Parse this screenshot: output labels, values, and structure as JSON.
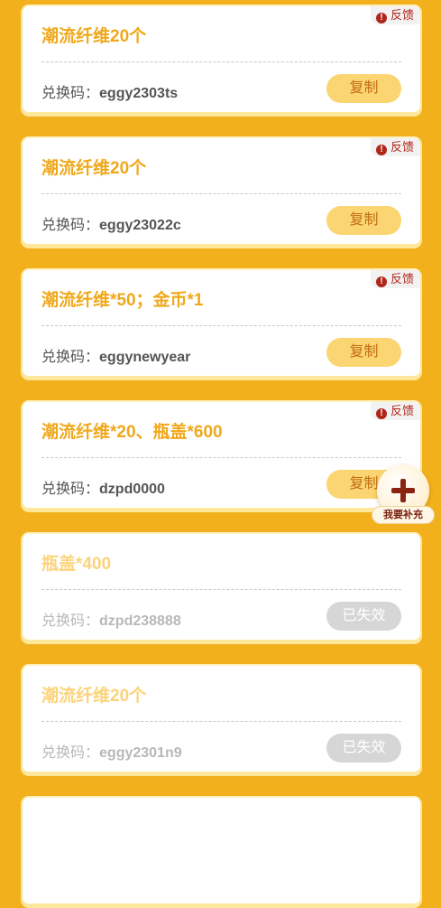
{
  "cards": [
    {
      "title": "潮流纤维20个",
      "code_label": "兑换码：",
      "code": "eggy2303ts",
      "button": "复制",
      "feedback": "反馈"
    },
    {
      "title": "潮流纤维20个",
      "code_label": "兑换码：",
      "code": "eggy23022c",
      "button": "复制",
      "feedback": "反馈"
    },
    {
      "title": "潮流纤维*50；金币*1",
      "code_label": "兑换码：",
      "code": "eggynewyear",
      "button": "复制",
      "feedback": "反馈"
    },
    {
      "title": "潮流纤维*20、瓶盖*600",
      "code_label": "兑换码：",
      "code": "dzpd0000",
      "button": "复制",
      "feedback": "反馈"
    },
    {
      "title": "瓶盖*400",
      "code_label": "兑换码：",
      "code": "dzpd238888",
      "button": "已失效",
      "status": "expired"
    },
    {
      "title": "潮流纤维20个",
      "code_label": "兑换码：",
      "code": "eggy2301n9",
      "button": "已失效",
      "status": "expired"
    }
  ],
  "fab": {
    "label": "我要补充",
    "icon": "plus-icon"
  },
  "colors": {
    "background": "#f2b01c",
    "title": "#f0a81a",
    "button": "#fbd571",
    "expired_button": "#d6d6d6",
    "feedback": "#b0251a"
  }
}
